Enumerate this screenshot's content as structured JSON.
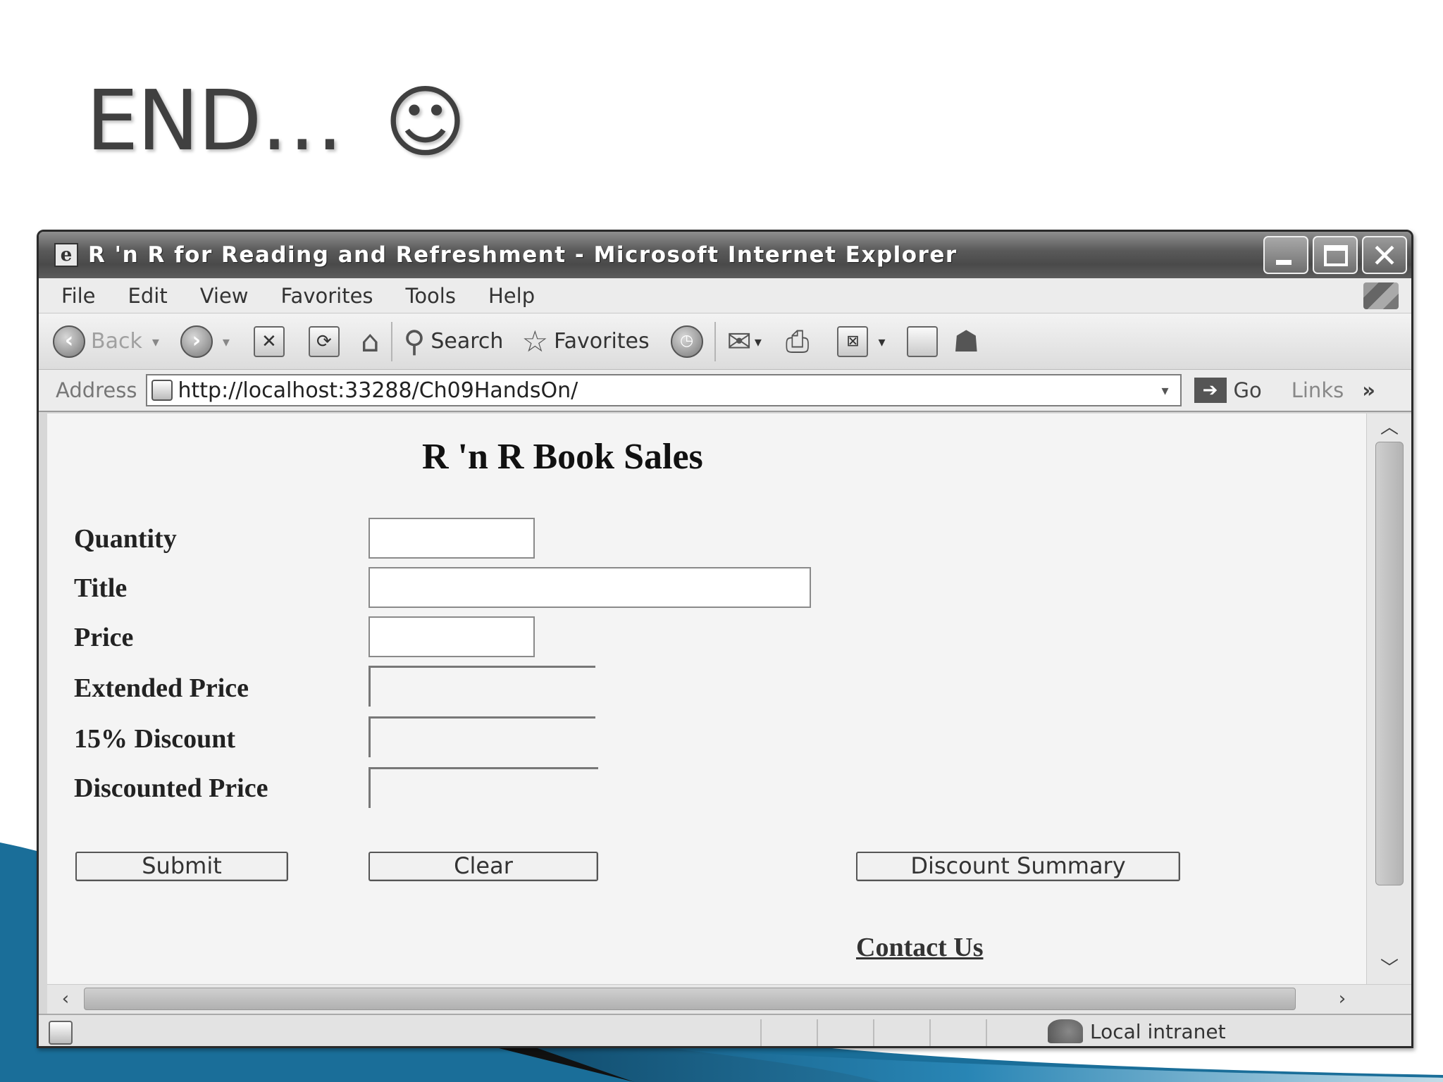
{
  "slide": {
    "title": "END… ",
    "smiley": "☺"
  },
  "window": {
    "title": "R 'n R for Reading and Refreshment - Microsoft Internet Explorer",
    "app_icon_glyph": "e",
    "menu": [
      "File",
      "Edit",
      "View",
      "Favorites",
      "Tools",
      "Help"
    ],
    "toolbar": {
      "back_label": "Back",
      "search_label": "Search",
      "favorites_label": "Favorites"
    },
    "address": {
      "label": "Address",
      "url": "http://localhost:33288/Ch09HandsOn/",
      "go_label": "Go",
      "links_label": "Links",
      "chevron": "»"
    },
    "status": {
      "zone": "Local intranet"
    }
  },
  "page": {
    "heading": "R 'n R Book Sales",
    "labels": {
      "quantity": "Quantity",
      "title": "Title",
      "price": "Price",
      "extended_price": "Extended Price",
      "discount": "15% Discount",
      "discounted_price": "Discounted Price"
    },
    "buttons": {
      "submit": "Submit",
      "clear": "Clear",
      "discount_summary": "Discount Summary"
    },
    "link_contact": "Contact Us"
  },
  "colors": {
    "titlebar": "#4a4a4a",
    "content_bg": "#f4f4f4",
    "deco_blue": "#1c6b93"
  }
}
